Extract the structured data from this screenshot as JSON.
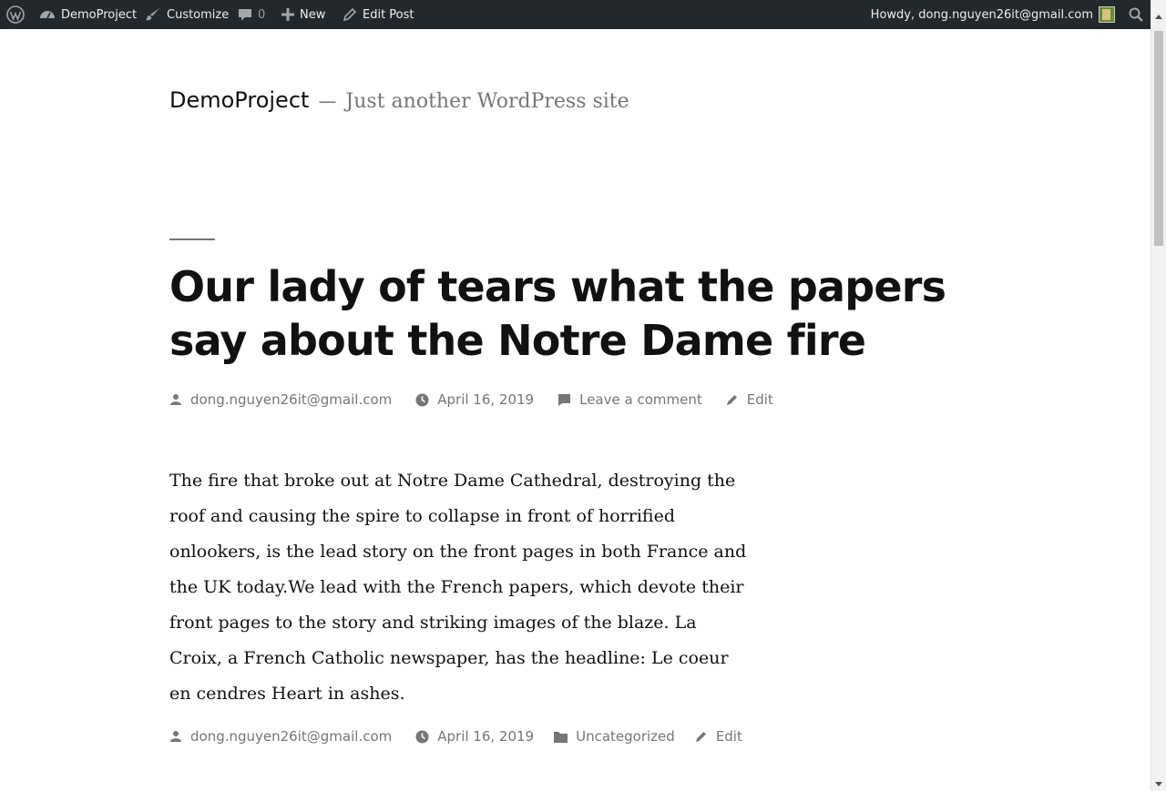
{
  "adminbar": {
    "site_name": "DemoProject",
    "customize": "Customize",
    "comments_count": "0",
    "new_label": "New",
    "edit_post": "Edit Post",
    "howdy": "Howdy, dong.nguyen26it@gmail.com"
  },
  "site": {
    "title": "DemoProject",
    "dash": "—",
    "tagline": "Just another WordPress site"
  },
  "post": {
    "title": "Our lady of tears what the papers say about the Notre Dame fire",
    "header_meta": {
      "author": "dong.nguyen26it@gmail.com",
      "date": "April 16, 2019",
      "comment": "Leave a comment",
      "edit": "Edit"
    },
    "body": "The fire that broke out at Notre Dame Cathedral, destroying the roof and causing the spire to collapse in front of horrified onlookers, is the lead story on the front pages in both France and the UK today.We lead with the French papers, which devote their front pages to the story and striking images of the blaze. La Croix, a French Catholic newspaper, has the headline: Le coeur en cendres Heart in ashes.",
    "footer_meta": {
      "author": "dong.nguyen26it@gmail.com",
      "date": "April 16, 2019",
      "category": "Uncategorized",
      "edit": "Edit"
    }
  },
  "icons": {
    "wp_logo": "wordpress-icon",
    "dashboard": "gauge-icon",
    "customize": "brush-icon",
    "comments": "comment-icon",
    "new": "plus-icon",
    "edit": "pencil-icon",
    "search": "search-icon",
    "author": "person-icon",
    "date": "clock-icon",
    "category": "folder-icon"
  },
  "colors": {
    "adminbar_bg": "#23282d",
    "meta_text": "#767676",
    "title_text": "#111111"
  }
}
